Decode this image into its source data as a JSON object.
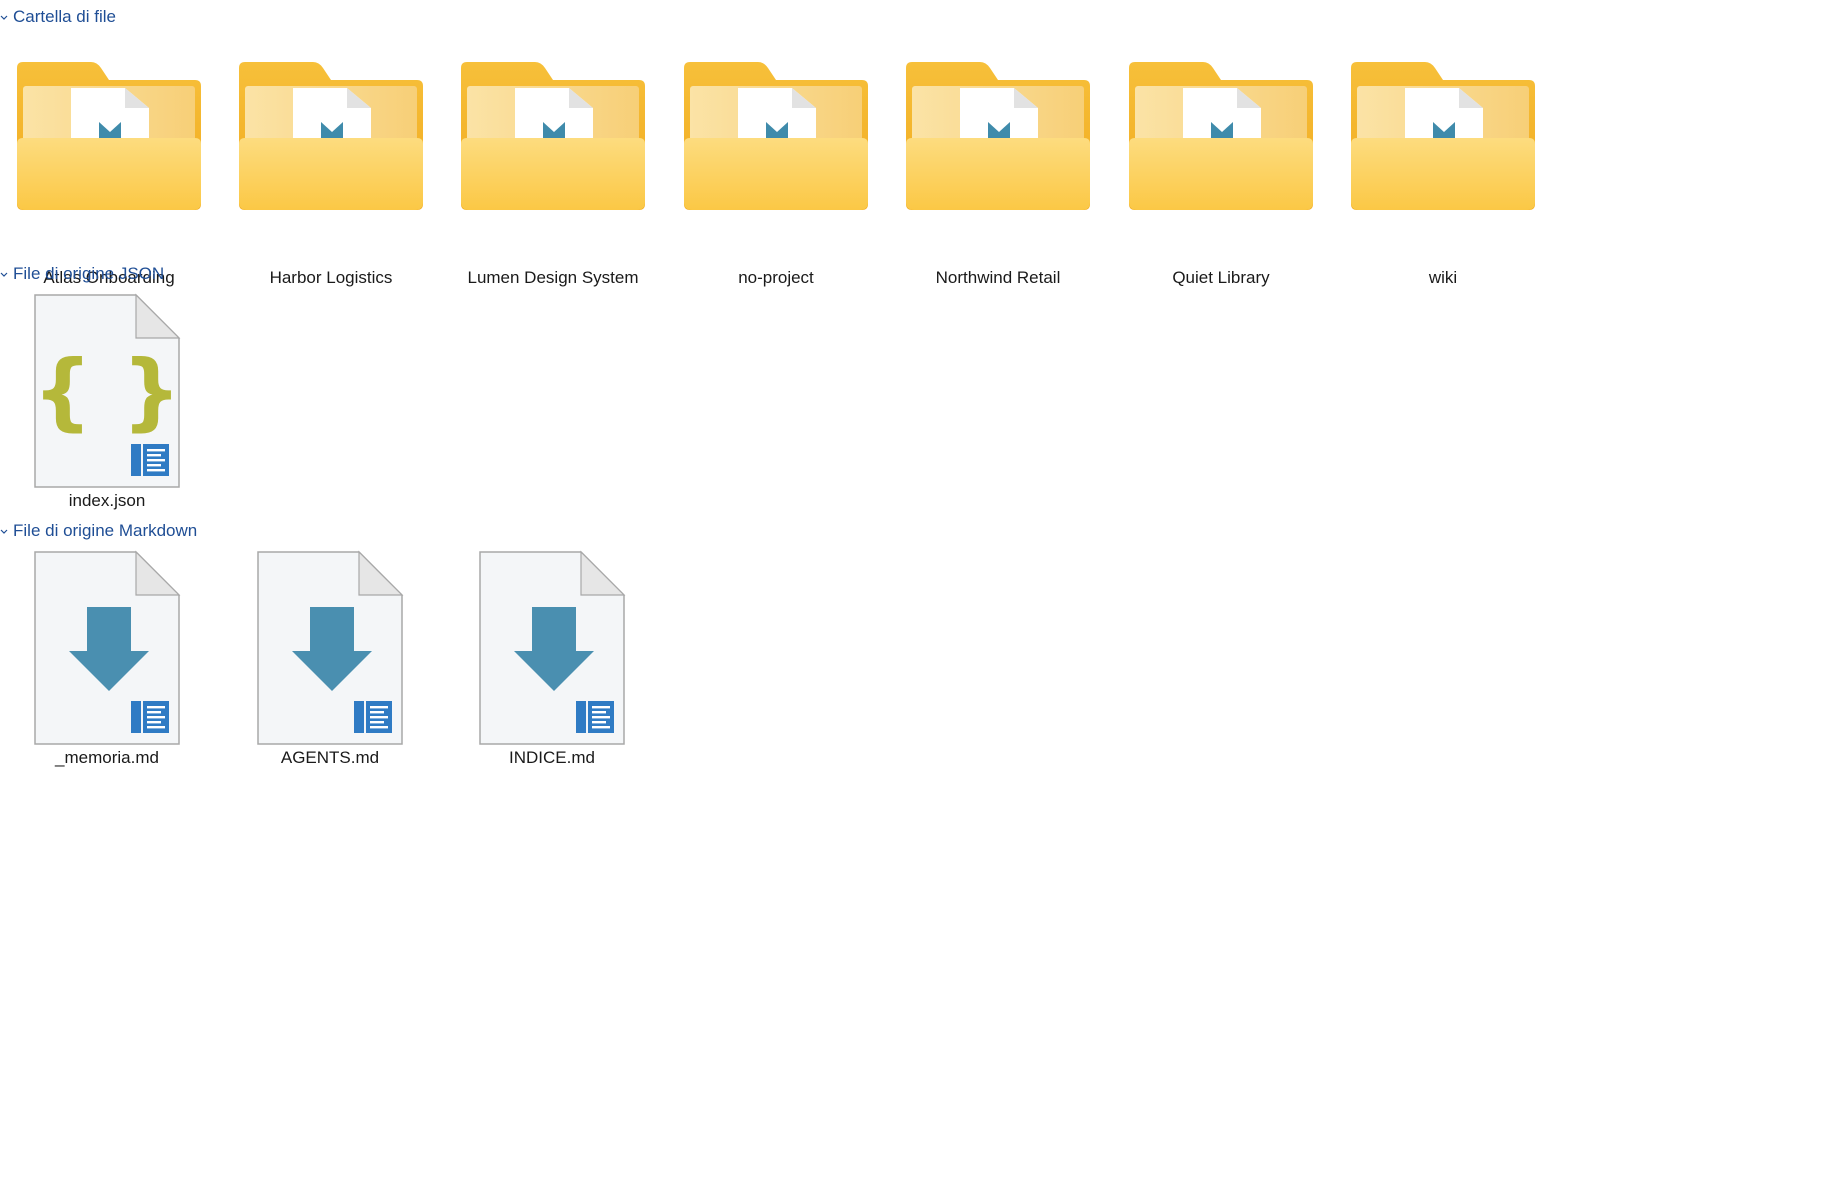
{
  "groups": [
    {
      "title": "Cartella di file",
      "items": [
        {
          "name": "Atlas Onboarding"
        },
        {
          "name": "Harbor Logistics"
        },
        {
          "name": "Lumen Design System"
        },
        {
          "name": "no-project"
        },
        {
          "name": "Northwind Retail"
        },
        {
          "name": "Quiet Library"
        },
        {
          "name": "wiki"
        }
      ]
    },
    {
      "title": "File di origine JSON",
      "items": [
        {
          "name": "index.json"
        }
      ]
    },
    {
      "title": "File di origine Markdown",
      "items": [
        {
          "name": "_memoria.md"
        },
        {
          "name": "AGENTS.md"
        },
        {
          "name": "INDICE.md"
        }
      ]
    }
  ],
  "colors": {
    "group_title": "#1f4e95",
    "folder_back": "#f5b82c",
    "folder_front": "#fcd166",
    "markdown_arrow": "#4a8fb0",
    "json_braces": "#b5b83a",
    "file_badge": "#2f7bc4"
  }
}
